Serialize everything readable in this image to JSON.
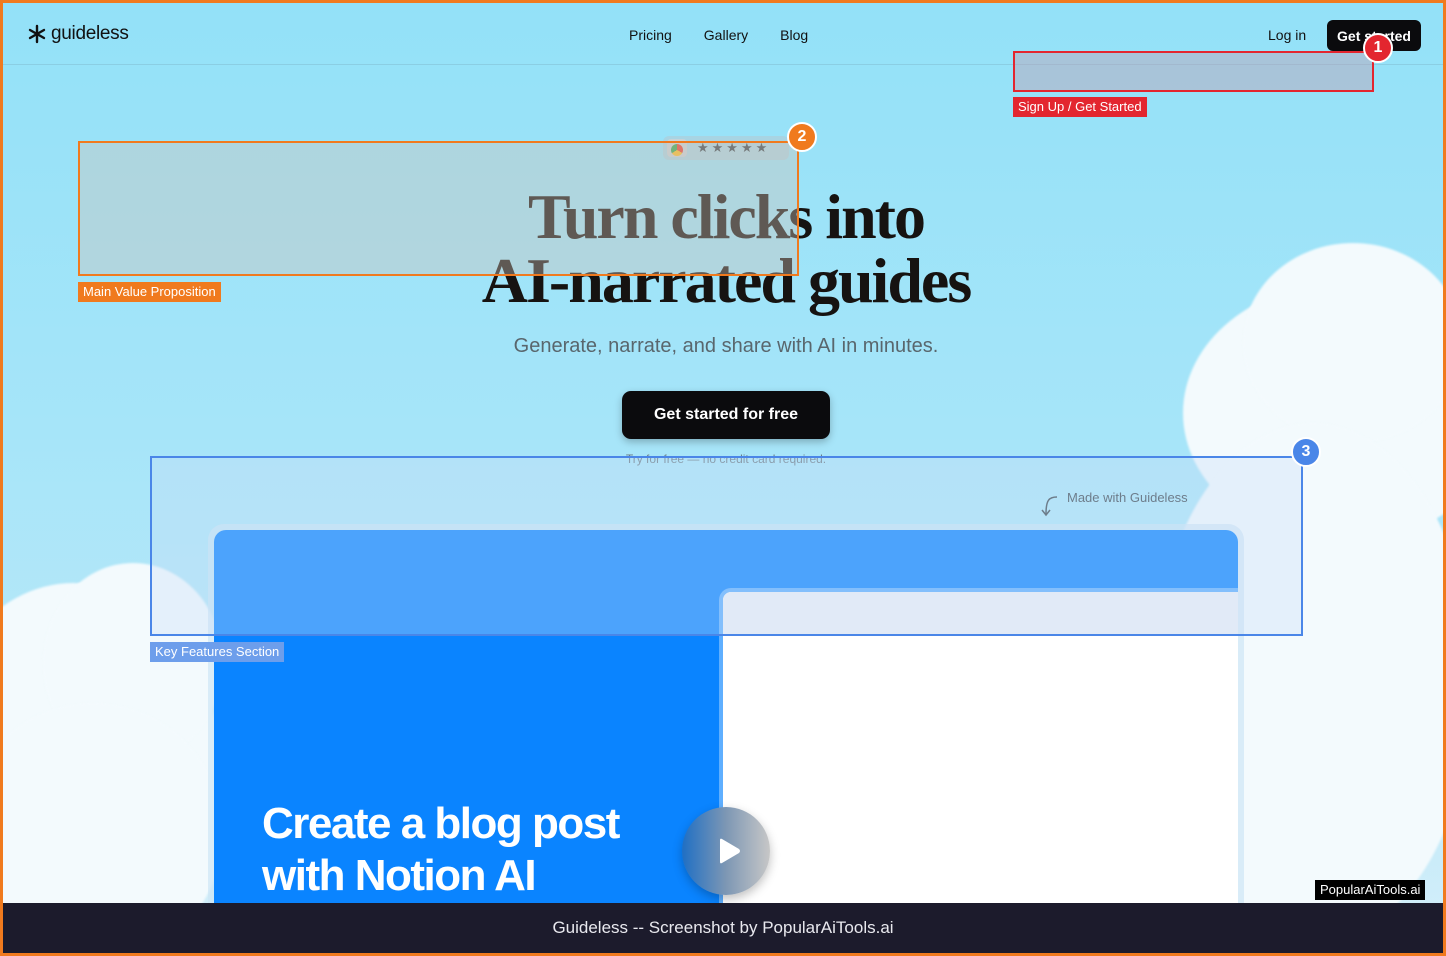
{
  "nav": {
    "brand": "guideless",
    "links": [
      "Pricing",
      "Gallery",
      "Blog"
    ],
    "login": "Log in",
    "get_started": "Get started"
  },
  "hero": {
    "rating_stars": "★★★★★",
    "headline_line1": "Turn clicks into",
    "headline_line2": "AI-narrated guides",
    "subheadline": "Generate, narrate, and share with AI in minutes.",
    "cta": "Get started for free",
    "cta_note": "Try for free — no credit card required.",
    "made_with": "Made with Guideless"
  },
  "video": {
    "title": "Create a blog post with Notion AI"
  },
  "annotations": [
    {
      "number": "1",
      "label": "Sign Up / Get Started",
      "color": "#e3262f"
    },
    {
      "number": "2",
      "label": "Main Value Proposition",
      "color": "#f07a1e"
    },
    {
      "number": "3",
      "label": "Key Features Section",
      "color": "#4a86e8"
    }
  ],
  "footer": {
    "caption": "Guideless -- Screenshot by PopularAiTools.ai",
    "watermark": "PopularAiTools.ai"
  }
}
